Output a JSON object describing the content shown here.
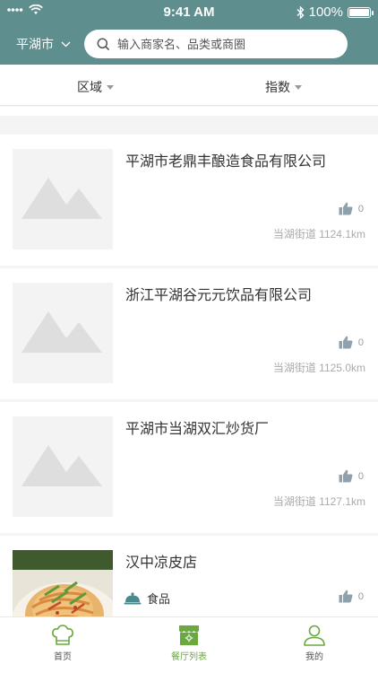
{
  "status_bar": {
    "time": "9:41 AM",
    "battery": "100%"
  },
  "header": {
    "city": "平湖市",
    "search_placeholder": "输入商家名、品类或商圈"
  },
  "filters": [
    {
      "label": "区域"
    },
    {
      "label": "指数"
    }
  ],
  "restaurants": [
    {
      "name": "平湖市老鼎丰酿造食品有限公司",
      "likes": "0",
      "address": "当湖街道 1124.1km"
    },
    {
      "name": "浙江平湖谷元元饮品有限公司",
      "likes": "0",
      "address": "当湖街道 1125.0km"
    },
    {
      "name": "平湖市当湖双汇炒货厂",
      "likes": "0",
      "address": "当湖街道 1127.1km"
    },
    {
      "name": "汉中凉皮店",
      "category": "食品",
      "likes": "0"
    }
  ],
  "tabs": [
    {
      "label": "首页"
    },
    {
      "label": "餐厅列表"
    },
    {
      "label": "我的"
    }
  ],
  "colors": {
    "header": "#5e8e8e",
    "accent": "#6aa93f",
    "placeholder": "#f3f3f3"
  }
}
